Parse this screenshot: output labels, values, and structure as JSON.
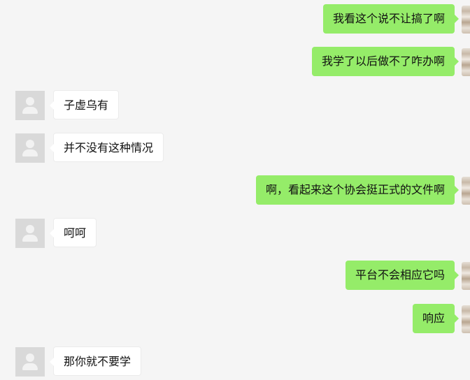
{
  "colors": {
    "background": "#f5f5f5",
    "sent_bubble": "#95ec69",
    "received_bubble": "#ffffff",
    "avatar_placeholder": "#d9d9d9"
  },
  "messages": [
    {
      "side": "right",
      "text": "我看这个说不让搞了啊"
    },
    {
      "side": "right",
      "text": "我学了以后做不了咋办啊"
    },
    {
      "side": "left",
      "text": "子虚乌有"
    },
    {
      "side": "left",
      "text": "并不没有这种情况"
    },
    {
      "side": "right",
      "text": "啊，看起来这个协会挺正式的文件啊"
    },
    {
      "side": "left",
      "text": "呵呵"
    },
    {
      "side": "right",
      "text": "平台不会相应它吗"
    },
    {
      "side": "right",
      "text": "响应"
    },
    {
      "side": "left",
      "text": "那你就不要学"
    }
  ]
}
